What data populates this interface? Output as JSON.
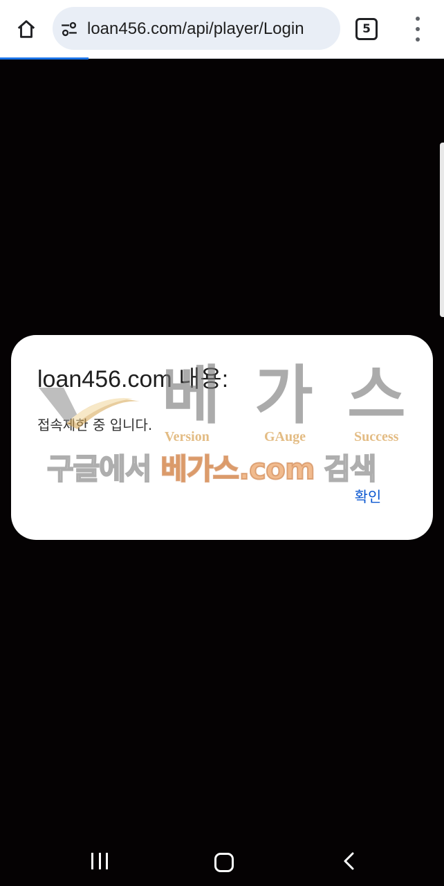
{
  "browser": {
    "url": "loan456.com/api/player/Login",
    "tab_count": "5",
    "icons": {
      "home": "home-icon",
      "site_settings": "site-settings-icon",
      "tabs": "tab-switcher-icon",
      "menu": "more-vert-icon"
    }
  },
  "dialog": {
    "title": "loan456.com 내용:",
    "message": "접속제한 중 입니다.",
    "confirm_label": "확인"
  },
  "watermark": {
    "big_chars": [
      "베",
      "가",
      "스"
    ],
    "subtitles": [
      "Version",
      "GAuge",
      "Success"
    ],
    "search_prefix": "구글에서",
    "search_brand": "베가스.com",
    "search_suffix": "검색"
  },
  "navbar": {
    "icons": {
      "recents": "recents-icon",
      "home": "home-circle-icon",
      "back": "back-icon"
    }
  },
  "colors": {
    "accent": "#1a73e8",
    "link": "#0b57d0",
    "background": "#050203"
  }
}
